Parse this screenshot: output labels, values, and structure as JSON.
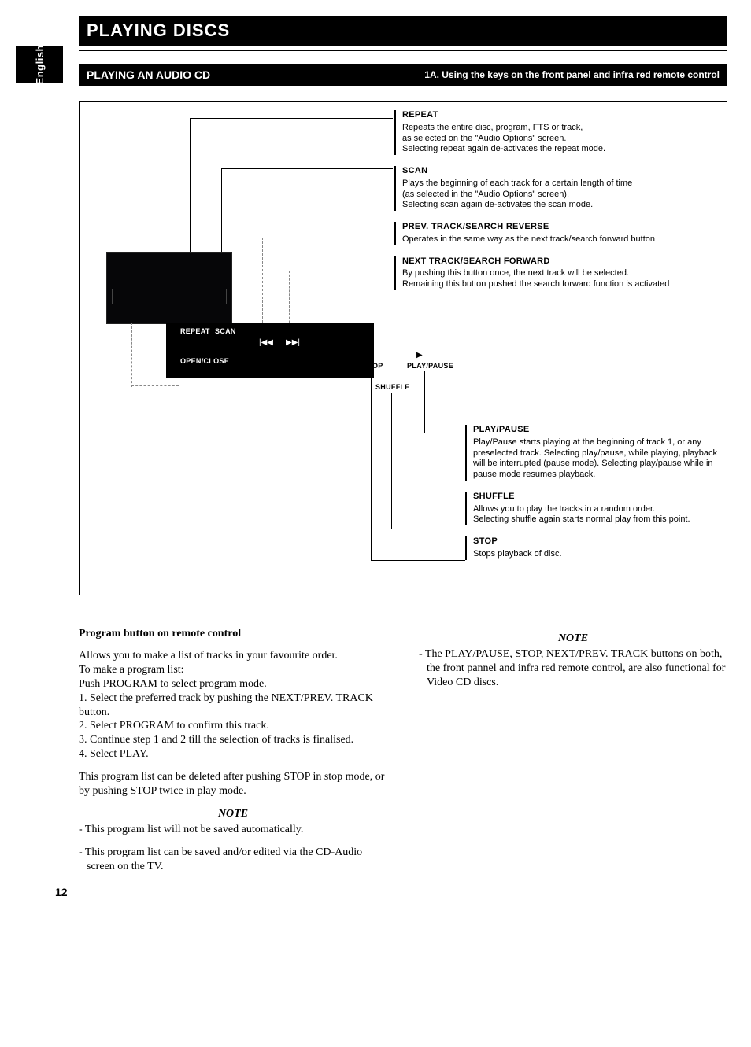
{
  "language_tab": "English",
  "page_number": "12",
  "title": "PLAYING DISCS",
  "section": {
    "heading": "PLAYING AN AUDIO CD",
    "subheading": "1A. Using the keys on the front panel and infra red remote control"
  },
  "diagram": {
    "panel_labels": {
      "repeat": "REPEAT",
      "scan": "SCAN",
      "open_close": "OPEN/CLOSE",
      "stop": "STOP",
      "play_pause": "PLAY/PAUSE",
      "shuffle": "SHUFFLE",
      "prev_glyph": "|◀◀",
      "next_glyph": "▶▶|",
      "stop_glyph": "■",
      "play_glyph": "▶"
    },
    "callouts_top": [
      {
        "title": "REPEAT",
        "body": "Repeats the entire disc, program, FTS or track,\nas selected on the \"Audio Options\" screen.\nSelecting repeat again de-activates the repeat mode."
      },
      {
        "title": "SCAN",
        "body": "Plays the beginning of each track for a certain length of time\n(as selected in the \"Audio Options\" screen).\nSelecting scan again de-activates the scan mode."
      },
      {
        "title": "PREV. TRACK/SEARCH REVERSE",
        "body": "Operates in the same way as the next track/search forward button"
      },
      {
        "title": "NEXT TRACK/SEARCH FORWARD",
        "body": "By pushing this button once, the next track will be selected.\nRemaining this button pushed the search forward function is activated"
      }
    ],
    "callouts_bottom": [
      {
        "title": "PLAY/PAUSE",
        "body": "Play/Pause starts playing at the beginning of track 1, or any preselected track. Selecting play/pause, while playing, playback will be interrupted (pause mode). Selecting play/pause while in pause mode resumes playback."
      },
      {
        "title": "SHUFFLE",
        "body": "Allows you to play the tracks in a random order.\nSelecting shuffle again starts normal play from this point."
      },
      {
        "title": "STOP",
        "body": "Stops playback of disc."
      }
    ]
  },
  "left_col": {
    "heading": "Program button on remote control",
    "p1": "Allows you to make a list of tracks in your favourite order.\nTo make a program list:\nPush PROGRAM to select program mode.\n1. Select the preferred track by pushing the NEXT/PREV. TRACK button.\n2. Select PROGRAM to confirm this track.\n3. Continue step 1 and 2 till the selection of tracks is finalised.\n4. Select PLAY.",
    "p2": "This program list can be deleted after pushing STOP in stop mode, or by pushing STOP twice in play mode.",
    "note_title": "NOTE",
    "notes": [
      "-  This program list will not be saved automatically.",
      "-  This program list can be saved and/or edited via the CD-Audio screen on the TV."
    ]
  },
  "right_col": {
    "note_title": "NOTE",
    "notes": [
      "-  The PLAY/PAUSE, STOP, NEXT/PREV. TRACK buttons on both, the front pannel and infra red remote control, are also functional for Video CD discs."
    ]
  }
}
